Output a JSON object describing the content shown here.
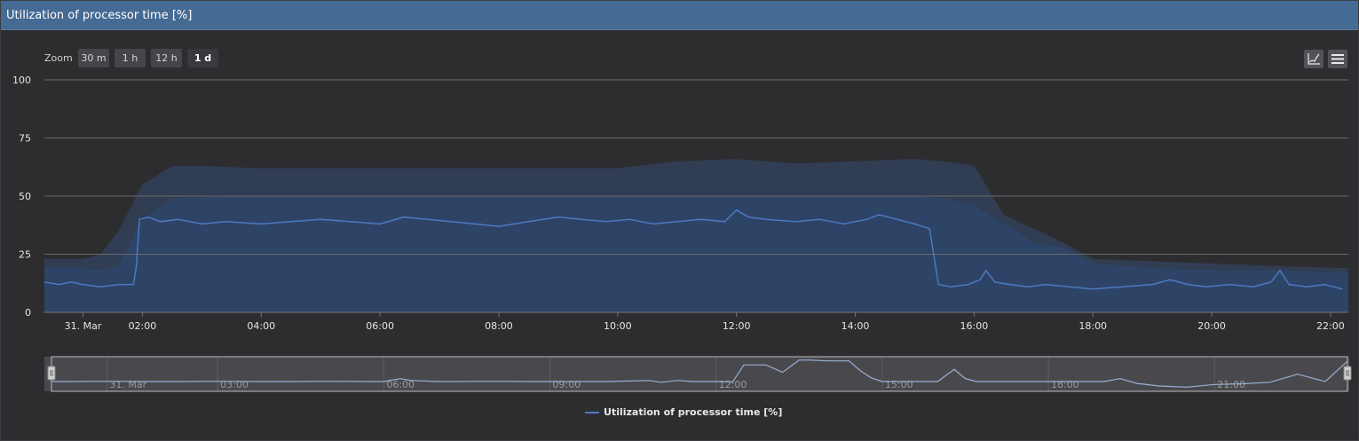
{
  "panel": {
    "title": "Utilization of processor time [%]"
  },
  "zoom": {
    "label": "Zoom",
    "buttons": [
      {
        "label": "30 m",
        "active": false
      },
      {
        "label": "1 h",
        "active": false
      },
      {
        "label": "12 h",
        "active": false
      },
      {
        "label": "1 d",
        "active": true
      }
    ]
  },
  "toolbar": {
    "chart_icon": "line-chart-icon",
    "menu_icon": "menu-icon"
  },
  "legend": {
    "label": "Utilization of processor time [%]",
    "color": "#4a7ac2"
  },
  "chart_data": {
    "type": "line",
    "title": "Utilization of processor time [%]",
    "ylim": [
      0,
      100
    ],
    "yticks": [
      "0",
      "25",
      "50",
      "75",
      "100"
    ],
    "xlim": [
      0.35,
      22.3
    ],
    "xticks": [
      {
        "label": "31. Mar",
        "h": 1.0
      },
      {
        "label": "02:00",
        "h": 2.0
      },
      {
        "label": "04:00",
        "h": 4.0
      },
      {
        "label": "06:00",
        "h": 6.0
      },
      {
        "label": "08:00",
        "h": 8.0
      },
      {
        "label": "10:00",
        "h": 10.0
      },
      {
        "label": "12:00",
        "h": 12.0
      },
      {
        "label": "14:00",
        "h": 14.0
      },
      {
        "label": "16:00",
        "h": 16.0
      },
      {
        "label": "18:00",
        "h": 18.0
      },
      {
        "label": "20:00",
        "h": 20.0
      },
      {
        "label": "22:00",
        "h": 22.0
      }
    ],
    "grid": true,
    "legend_position": "bottom-center",
    "series": [
      {
        "name": "Utilization of processor time [%]",
        "color": "#4a7ac2",
        "x": [
          0.35,
          0.6,
          0.8,
          1.0,
          1.3,
          1.6,
          1.85,
          1.9,
          1.95,
          2.1,
          2.3,
          2.6,
          3.0,
          3.4,
          4.0,
          4.5,
          5.0,
          5.5,
          6.0,
          6.4,
          6.8,
          7.2,
          7.6,
          8.0,
          8.5,
          9.0,
          9.4,
          9.8,
          10.2,
          10.6,
          11.0,
          11.4,
          11.8,
          12.0,
          12.2,
          12.5,
          13.0,
          13.4,
          13.8,
          14.2,
          14.4,
          14.7,
          15.0,
          15.25,
          15.35,
          15.4,
          15.6,
          15.9,
          16.1,
          16.2,
          16.35,
          16.6,
          16.9,
          17.2,
          17.6,
          18.0,
          18.5,
          19.0,
          19.3,
          19.6,
          19.9,
          20.3,
          20.7,
          21.0,
          21.15,
          21.3,
          21.6,
          21.9,
          22.2
        ],
        "values": [
          13,
          12,
          13,
          12,
          11,
          12,
          12,
          20,
          40,
          41,
          39,
          40,
          38,
          39,
          38,
          39,
          40,
          39,
          38,
          41,
          40,
          39,
          38,
          37,
          39,
          41,
          40,
          39,
          40,
          38,
          39,
          40,
          39,
          44,
          41,
          40,
          39,
          40,
          38,
          40,
          42,
          40,
          38,
          36,
          20,
          12,
          11,
          12,
          14,
          18,
          13,
          12,
          11,
          12,
          11,
          10,
          11,
          12,
          14,
          12,
          11,
          12,
          11,
          13,
          18,
          12,
          11,
          12,
          10
        ]
      },
      {
        "name": "",
        "role": "inner-band",
        "x": [
          0.35,
          1.0,
          1.3,
          1.6,
          2.0,
          2.5,
          3.5,
          5.0,
          7.0,
          9.0,
          11.0,
          13.0,
          15.0,
          15.5,
          16.0,
          16.5,
          17.0,
          17.5,
          18.0,
          19.0,
          20.0,
          21.0,
          22.3
        ],
        "values": [
          19,
          19,
          18,
          20,
          40,
          49,
          50,
          50,
          50,
          50,
          50,
          50,
          50,
          49,
          46,
          38,
          30,
          28,
          21,
          19,
          18,
          18,
          17
        ]
      },
      {
        "name": "",
        "role": "outer-band",
        "x": [
          0.35,
          1.0,
          1.3,
          1.6,
          2.0,
          2.5,
          3.0,
          4.0,
          6.0,
          8.0,
          10.0,
          11.0,
          12.0,
          13.0,
          14.0,
          15.0,
          15.5,
          16.0,
          16.5,
          17.0,
          17.5,
          18.0,
          19.0,
          20.0,
          21.0,
          22.3
        ],
        "values": [
          23,
          23,
          25,
          35,
          55,
          63,
          63,
          62,
          62,
          62,
          62,
          65,
          66,
          64,
          65,
          66,
          65,
          63,
          42,
          36,
          30,
          23,
          22,
          21,
          20,
          19
        ]
      }
    ],
    "navigator": {
      "xticks": [
        {
          "label": "31. Mar",
          "h": 1.0
        },
        {
          "label": "03:00",
          "h": 3.0
        },
        {
          "label": "06:00",
          "h": 6.0
        },
        {
          "label": "09:00",
          "h": 9.0
        },
        {
          "label": "12:00",
          "h": 12.0
        },
        {
          "label": "15:00",
          "h": 15.0
        },
        {
          "label": "18:00",
          "h": 18.0
        },
        {
          "label": "21:00",
          "h": 21.0
        }
      ],
      "x": [
        0.0,
        1.0,
        2.0,
        3.0,
        4.0,
        5.0,
        6.0,
        6.3,
        6.5,
        7.0,
        8.0,
        9.0,
        10.0,
        10.8,
        11.0,
        11.3,
        11.6,
        12.0,
        12.3,
        12.5,
        12.9,
        13.2,
        13.5,
        13.7,
        14.0,
        14.4,
        14.6,
        14.8,
        15.0,
        15.5,
        16.0,
        16.3,
        16.5,
        16.7,
        17.0,
        17.5,
        18.0,
        18.5,
        19.0,
        19.3,
        19.6,
        20.0,
        20.5,
        21.0,
        21.5,
        22.0,
        22.5,
        23.0,
        23.4
      ],
      "values": [
        0,
        0.5,
        0,
        0.5,
        0,
        0.5,
        0,
        8,
        3,
        0,
        0.5,
        0,
        0,
        3,
        -2,
        3,
        0,
        0,
        -1,
        45,
        45,
        25,
        58,
        58,
        56,
        56,
        30,
        10,
        0,
        0,
        0,
        33,
        8,
        0,
        0,
        0,
        0,
        0,
        0,
        8,
        -5,
        -12,
        -15,
        -8,
        -6,
        -2,
        20,
        0,
        55
      ]
    }
  }
}
